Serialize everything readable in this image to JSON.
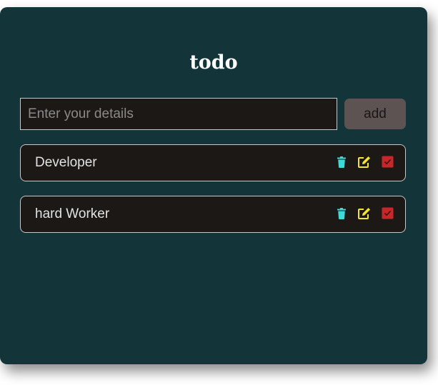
{
  "app": {
    "title": "todo"
  },
  "input": {
    "placeholder": "Enter your details",
    "value": ""
  },
  "add_button": {
    "label": "add"
  },
  "items": [
    {
      "label": "Developer",
      "completed": true
    },
    {
      "label": "hard Worker",
      "completed": true
    }
  ],
  "icons": {
    "delete": "trash-icon",
    "edit": "edit-icon",
    "complete": "checkbox-icon"
  },
  "colors": {
    "background": "#133438",
    "item_background": "#1b1815",
    "trash": "#3ddad7",
    "edit": "#f5e23a",
    "checkbox": "#c8272a",
    "button": "#5d5352"
  }
}
